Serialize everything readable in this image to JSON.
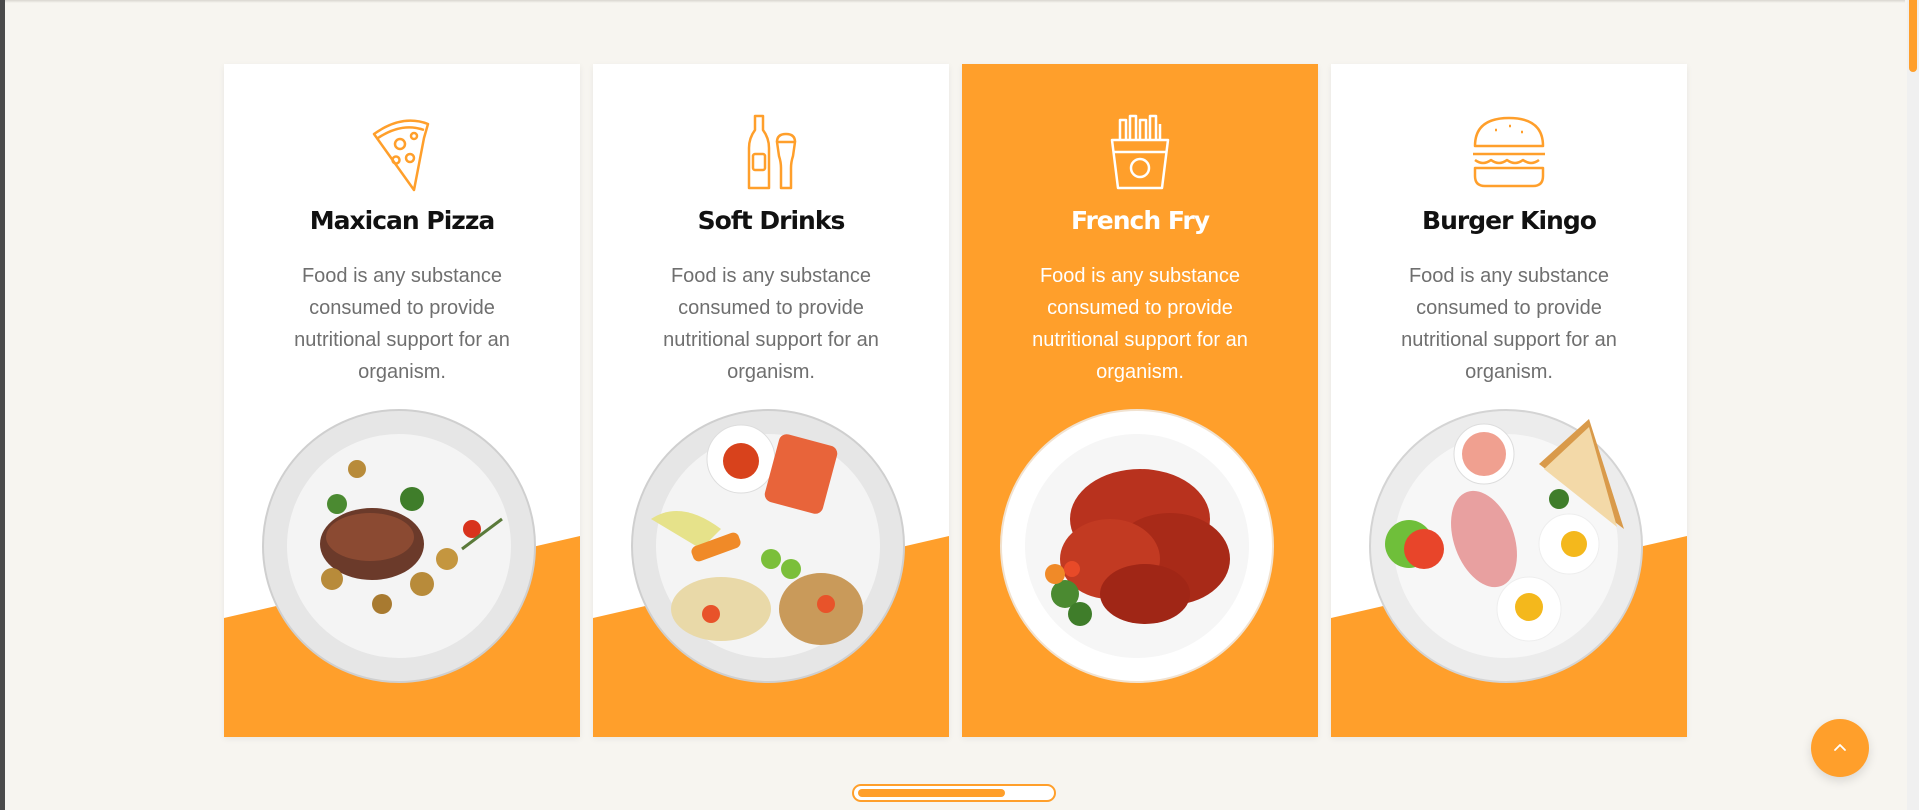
{
  "cards": [
    {
      "title": "Maxican Pizza",
      "desc": "Food is any substance consumed to provide nutritional support for an organism.",
      "icon": "pizza-slice-icon"
    },
    {
      "title": "Soft Drinks",
      "desc": "Food is any substance consumed to provide nutritional support for an organism.",
      "icon": "bottle-and-glass-icon"
    },
    {
      "title": "French Fry",
      "desc": "Food is any substance consumed to provide nutritional support for an organism.",
      "icon": "french-fries-icon"
    },
    {
      "title": "Burger Kingo",
      "desc": "Food is any substance consumed to provide nutritional support for an organism.",
      "icon": "burger-icon"
    }
  ],
  "carousel": {
    "progress": 0.75
  },
  "colors": {
    "accent": "#ff9f2b",
    "background": "#f7f5f0",
    "title": "#111111",
    "text": "#6f6f6f"
  },
  "back_to_top": {
    "icon": "chevron-up-icon"
  }
}
